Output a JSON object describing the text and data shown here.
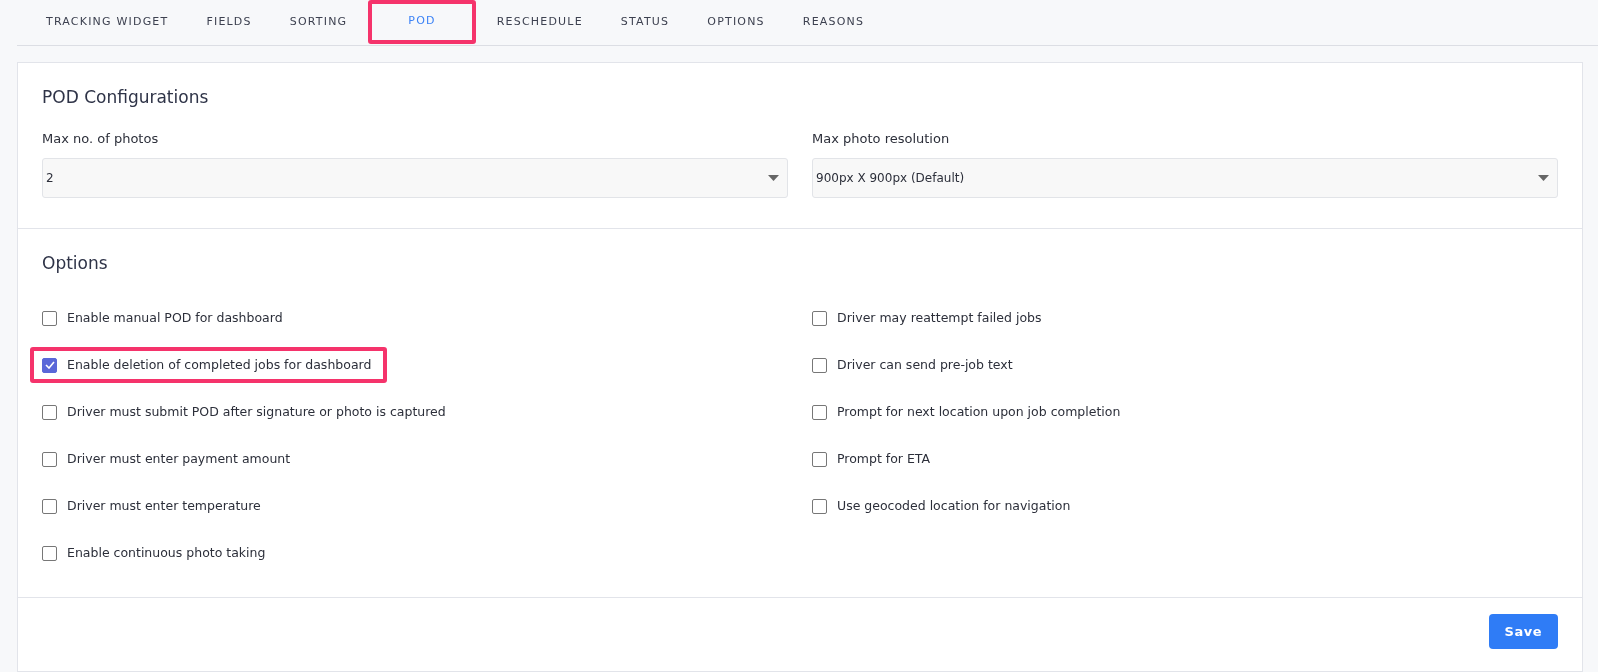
{
  "tabs": [
    {
      "label": "TRACKING WIDGET",
      "selected": false,
      "highlighted": false
    },
    {
      "label": "FIELDS",
      "selected": false,
      "highlighted": false
    },
    {
      "label": "SORTING",
      "selected": false,
      "highlighted": false
    },
    {
      "label": "POD",
      "selected": true,
      "highlighted": true
    },
    {
      "label": "RESCHEDULE",
      "selected": false,
      "highlighted": false
    },
    {
      "label": "STATUS",
      "selected": false,
      "highlighted": false
    },
    {
      "label": "OPTIONS",
      "selected": false,
      "highlighted": false
    },
    {
      "label": "REASONS",
      "selected": false,
      "highlighted": false
    }
  ],
  "configurations": {
    "title": "POD Configurations",
    "fields": [
      {
        "label": "Max no. of photos",
        "value": "2"
      },
      {
        "label": "Max photo resolution",
        "value": "900px X 900px (Default)"
      }
    ]
  },
  "options": {
    "title": "Options",
    "columns": [
      [
        {
          "label": "Enable manual POD for dashboard",
          "checked": false,
          "highlighted": false
        },
        {
          "label": "Enable deletion of completed jobs for dashboard",
          "checked": true,
          "highlighted": true
        },
        {
          "label": "Driver must submit POD after signature or photo is captured",
          "checked": false,
          "highlighted": false
        },
        {
          "label": "Driver must enter payment amount",
          "checked": false,
          "highlighted": false
        },
        {
          "label": "Driver must enter temperature",
          "checked": false,
          "highlighted": false
        },
        {
          "label": "Enable continuous photo taking",
          "checked": false,
          "highlighted": false
        }
      ],
      [
        {
          "label": "Driver may reattempt failed jobs",
          "checked": false,
          "highlighted": false
        },
        {
          "label": "Driver can send pre-job text",
          "checked": false,
          "highlighted": false
        },
        {
          "label": "Prompt for next location upon job completion",
          "checked": false,
          "highlighted": false
        },
        {
          "label": "Prompt for ETA",
          "checked": false,
          "highlighted": false
        },
        {
          "label": "Use geocoded location for navigation",
          "checked": false,
          "highlighted": false
        }
      ]
    ]
  },
  "save_button": "Save"
}
